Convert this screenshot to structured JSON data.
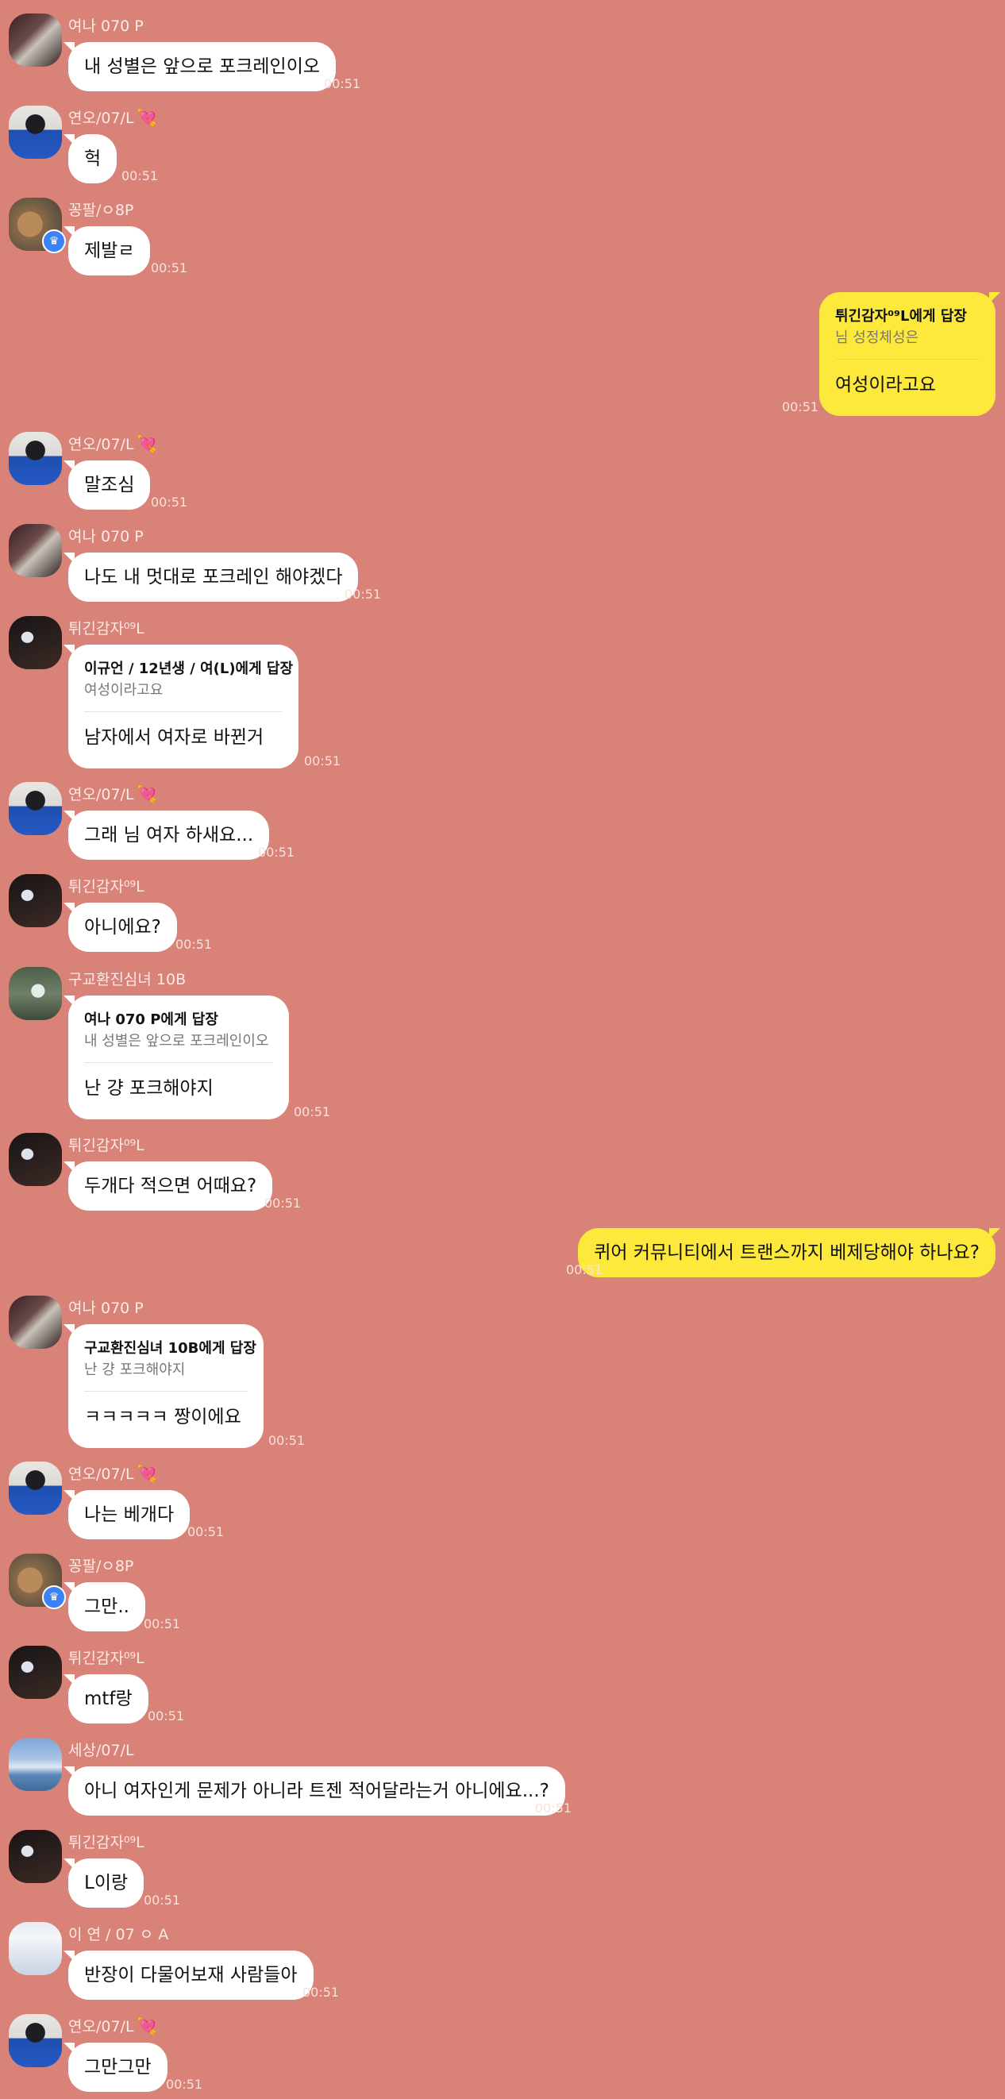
{
  "time": "00:51",
  "messages": [
    {
      "sender": "여나 070 P",
      "avatar": "avatar-window-photo",
      "text": "내 성별은 앞으로 포크레인이오"
    },
    {
      "sender": "연오/07/L",
      "heart": "💘",
      "avatar": "avatar-blue-jacket-photo",
      "text": "헉"
    },
    {
      "sender": "꽁팔/ㅇ8P",
      "avatar": "avatar-cat-crown-photo",
      "text": "제발ㄹ"
    },
    {
      "mine": true,
      "reply_to": "튀긴감자⁰⁹L에게 답장",
      "quote": "님 성정체성은",
      "text": "여성이라고요"
    },
    {
      "sender": "연오/07/L",
      "heart": "💘",
      "avatar": "avatar-blue-jacket-photo",
      "text": "말조심"
    },
    {
      "sender": "여나 070 P",
      "avatar": "avatar-window-photo",
      "text": "나도 내 멋대로 포크레인 해야겠다"
    },
    {
      "sender": "튀긴감자⁰⁹L",
      "avatar": "avatar-dark-sign-photo",
      "reply_to": "이규언 / 12년생 / 여(L)에게 답장",
      "quote": "여성이라고요",
      "text": "남자에서 여자로 바뀐거"
    },
    {
      "sender": "연오/07/L",
      "heart": "💘",
      "avatar": "avatar-blue-jacket-photo",
      "text": "그래 님 여자 하새요..."
    },
    {
      "sender": "튀긴감자⁰⁹L",
      "avatar": "avatar-dark-sign-photo",
      "text": "아니에요?"
    },
    {
      "sender": "구교환진심녀 10B",
      "avatar": "avatar-green-person-photo",
      "reply_to": "여나 070 P에게 답장",
      "quote": "내 성별은 앞으로 포크레인이오",
      "text": "난 걍 포크해야지"
    },
    {
      "sender": "튀긴감자⁰⁹L",
      "avatar": "avatar-dark-sign-photo",
      "text": "두개다 적으면 어때요?"
    },
    {
      "mine": true,
      "text": "퀴어 커뮤니티에서 트랜스까지 베제당해야 하나요?"
    },
    {
      "sender": "여나 070 P",
      "avatar": "avatar-window-photo",
      "reply_to": "구교환진심녀 10B에게 답장",
      "quote": "난 걍 포크해야지",
      "text": "ㅋㅋㅋㅋㅋ 짱이에요"
    },
    {
      "sender": "연오/07/L",
      "heart": "💘",
      "avatar": "avatar-blue-jacket-photo",
      "text": "나는 베개다"
    },
    {
      "sender": "꽁팔/ㅇ8P",
      "avatar": "avatar-cat-crown-photo",
      "text": "그만.."
    },
    {
      "sender": "튀긴감자⁰⁹L",
      "avatar": "avatar-dark-sign-photo",
      "text": "mtf랑"
    },
    {
      "sender": "세상/07/L",
      "avatar": "avatar-sky-photo",
      "text": "아니 여자인게 문제가 아니라 트젠 적어달라는거 아니에요...?"
    },
    {
      "sender": "튀긴감자⁰⁹L",
      "avatar": "avatar-dark-sign-photo",
      "text": "L이랑"
    },
    {
      "sender": "이 연 / 07 ㅇ A",
      "avatar": "avatar-screenshot-photo",
      "text": "반장이 다물어보재 사람들아"
    },
    {
      "sender": "연오/07/L",
      "heart": "💘",
      "avatar": "avatar-blue-jacket-photo",
      "text": "그만그만"
    }
  ]
}
